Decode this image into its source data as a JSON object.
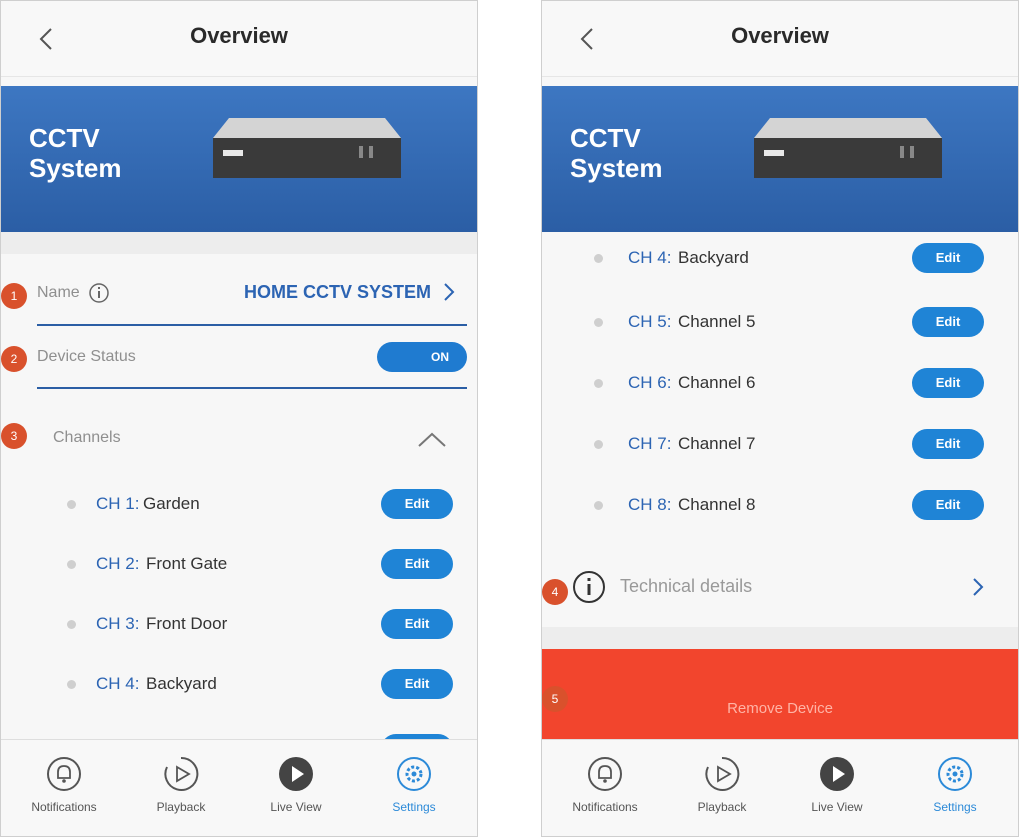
{
  "header": {
    "title": "Overview"
  },
  "hero": {
    "device_title": "CCTV\nSystem"
  },
  "settings": {
    "name_label": "Name",
    "name_value": "HOME CCTV SYSTEM",
    "status_label": "Device Status",
    "status_toggle": "ON",
    "channels_label": "Channels",
    "technical_label": "Technical details",
    "remove_label": "Remove Device"
  },
  "channels": [
    {
      "num": "CH 1:",
      "name": "Garden",
      "edit": "Edit"
    },
    {
      "num": "CH 2:",
      "name": "Front Gate",
      "edit": "Edit"
    },
    {
      "num": "CH 3:",
      "name": "Front Door",
      "edit": "Edit"
    },
    {
      "num": "CH 4:",
      "name": "Backyard",
      "edit": "Edit"
    },
    {
      "num": "CH 5:",
      "name": "Channel 5",
      "edit": "Edit"
    },
    {
      "num": "CH 6:",
      "name": "Channel 6",
      "edit": "Edit"
    },
    {
      "num": "CH 7:",
      "name": "Channel 7",
      "edit": "Edit"
    },
    {
      "num": "CH 8:",
      "name": "Channel 8",
      "edit": "Edit"
    }
  ],
  "tabs": [
    {
      "label": "Notifications",
      "icon": "bell-icon"
    },
    {
      "label": "Playback",
      "icon": "playback-icon"
    },
    {
      "label": "Live View",
      "icon": "live-view-icon"
    },
    {
      "label": "Settings",
      "icon": "settings-icon",
      "active": true
    }
  ],
  "badges": [
    "1",
    "2",
    "3",
    "4",
    "5"
  ],
  "colors": {
    "brand_blue": "#2b5ea5",
    "accent_blue": "#1f84d6",
    "badge": "#d9512c",
    "danger": "#f2452d"
  }
}
